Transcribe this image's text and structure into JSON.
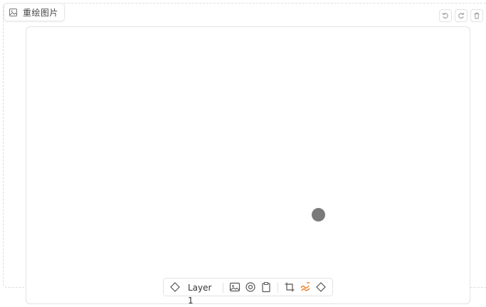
{
  "tab": {
    "label": "重绘图片",
    "icon": "image-icon"
  },
  "actions": {
    "undo_icon": "undo-icon",
    "redo_icon": "redo-icon",
    "delete_icon": "trash-icon"
  },
  "canvas": {
    "brush_color": "#7a7a7a"
  },
  "toolbar": {
    "layer_label": "Layer 1",
    "icons": [
      "layers-icon",
      "image-upload-icon",
      "webcam-icon",
      "clipboard-icon",
      "crop-icon",
      "brush-icon",
      "eraser-icon"
    ],
    "active_tool": "brush-icon",
    "accent_color": "#e8710a"
  }
}
